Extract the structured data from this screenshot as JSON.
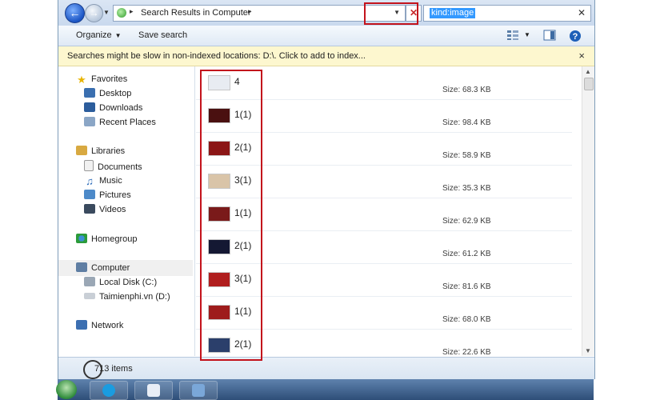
{
  "address_bar": {
    "path_root_icon": "search-results-icon",
    "path_text": "Search Results in Computer",
    "back_icon": "back-arrow-icon",
    "forward_icon": "forward-arrow-icon",
    "stop_icon": "close-x-icon"
  },
  "search": {
    "value": "kind:image"
  },
  "toolbar": {
    "organize": "Organize",
    "save_search": "Save search"
  },
  "infobar": {
    "text": "Searches might be slow in non-indexed locations: D:\\. Click to add to index...",
    "close": "×"
  },
  "nav": {
    "favorites": "Favorites",
    "desktop": "Desktop",
    "downloads": "Downloads",
    "recent_places": "Recent Places",
    "libraries": "Libraries",
    "documents": "Documents",
    "music": "Music",
    "pictures": "Pictures",
    "videos": "Videos",
    "homegroup": "Homegroup",
    "computer": "Computer",
    "local_disk": "Local Disk (C:)",
    "drive_d": "Taimienphi.vn (D:)",
    "network": "Network"
  },
  "files": [
    {
      "name": "4",
      "size": "Size: 68.3 KB",
      "thumb": "#e8ecf2"
    },
    {
      "name": "1(1)",
      "size": "Size: 98.4 KB",
      "thumb": "#4a1010"
    },
    {
      "name": "2(1)",
      "size": "Size: 58.9 KB",
      "thumb": "#8b1616"
    },
    {
      "name": "3(1)",
      "size": "Size: 35.3 KB",
      "thumb": "#d9c4a8"
    },
    {
      "name": "1(1)",
      "size": "Size: 62.9 KB",
      "thumb": "#7a1a1a"
    },
    {
      "name": "2(1)",
      "size": "Size: 61.2 KB",
      "thumb": "#141833"
    },
    {
      "name": "3(1)",
      "size": "Size: 81.6 KB",
      "thumb": "#b01e1e"
    },
    {
      "name": "1(1)",
      "size": "Size: 68.0 KB",
      "thumb": "#9e1c1c"
    },
    {
      "name": "2(1)",
      "size": "Size: 22.6 KB",
      "thumb": "#2b3f6b"
    }
  ],
  "status": {
    "item_count": "713 items"
  },
  "colors": {
    "highlight_box": "#c3131c",
    "infobar_bg": "#fdf7cf",
    "selection": "#3399ff"
  }
}
